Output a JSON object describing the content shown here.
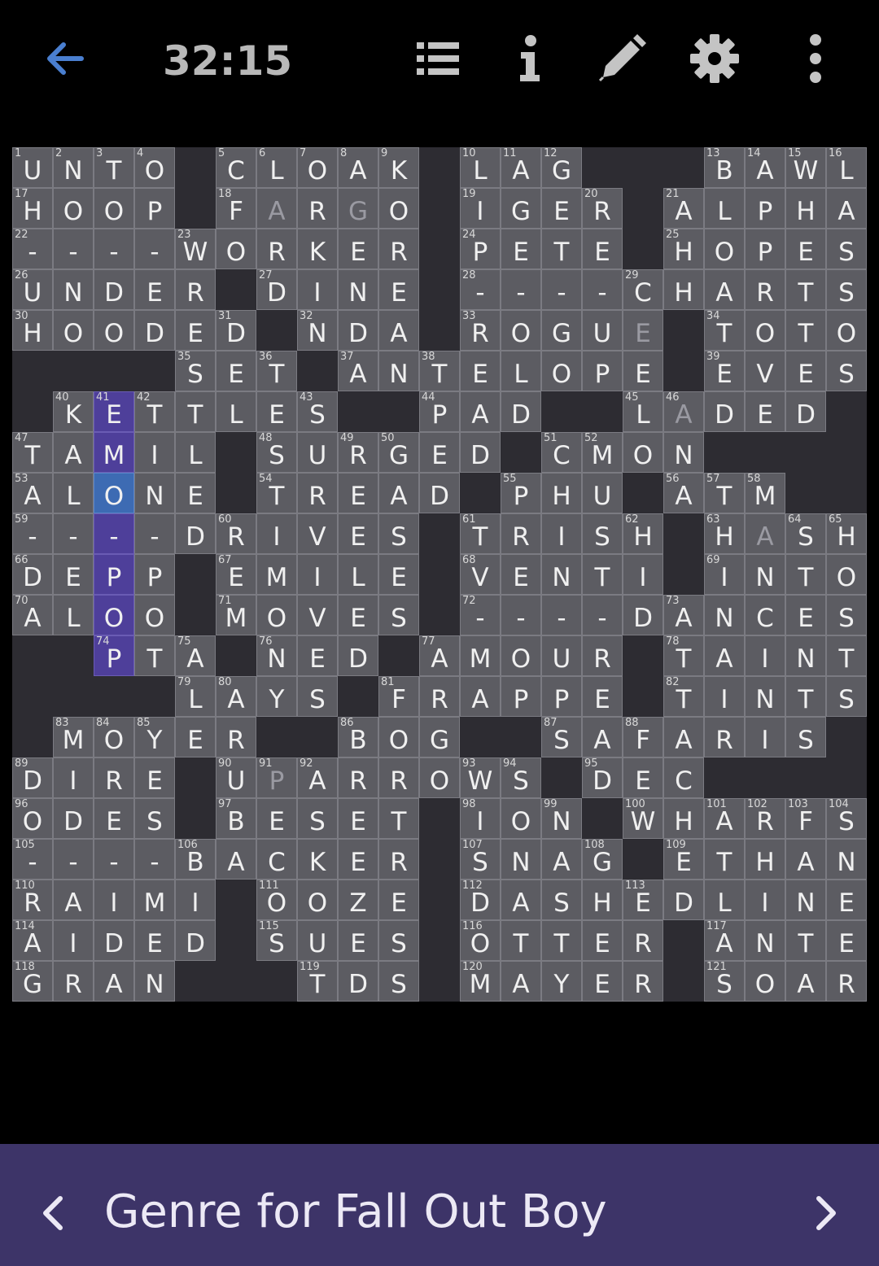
{
  "toolbar": {
    "timer": "32:15",
    "icons": [
      "back-arrow-icon",
      "clue-list-icon",
      "info-icon",
      "pencil-icon",
      "gear-icon",
      "more-vertical-icon"
    ],
    "colors": {
      "back_arrow": "#4a7fd0",
      "icons": "#c4c4c4",
      "timer": "#b8b8b8"
    }
  },
  "grid": {
    "size": 21,
    "rows": [
      "UNTO.CLOAK.LAG...BAWL",
      "HOOP.FARGO.IGER.ALPHA",
      "----WORKER.PETE.HOPES",
      "UNDER.DINE.----CHARTS",
      "HOODED.NDA.ROGUE.TOTO",
      "....SET.ANTELOPE.EVES",
      ".KETTLES..PAD..LADED.",
      "TAMIL.SURGED.CMON....",
      "ALONE.TREAD.PHU.ATM..",
      "----DRIVES.TRISH.HASH",
      "DEPP.EMILE.VENTI.INTO",
      "ALOO.MOVES.----DANCES",
      "..PTA.NED.AMOUR.TAINT",
      "....LAYS.FRAPPE.TINTS",
      ".MOYER..BOG..SAFARIS.",
      "DIRE.UPARROWS.DEC....",
      "ODES.BESET.ION.WHARFS",
      "----BACKER.SNAG.ETHAN",
      "RAIMI.OOZE.DASHEDLINE",
      "AIDED.SUES.OTTER.ANTE",
      "GRAN...TDS.MAYER.SOAR"
    ],
    "numbers": [
      {
        "r": 0,
        "c": 0,
        "n": "1"
      },
      {
        "r": 0,
        "c": 1,
        "n": "2"
      },
      {
        "r": 0,
        "c": 2,
        "n": "3"
      },
      {
        "r": 0,
        "c": 3,
        "n": "4"
      },
      {
        "r": 0,
        "c": 5,
        "n": "5"
      },
      {
        "r": 0,
        "c": 6,
        "n": "6"
      },
      {
        "r": 0,
        "c": 7,
        "n": "7"
      },
      {
        "r": 0,
        "c": 8,
        "n": "8"
      },
      {
        "r": 0,
        "c": 9,
        "n": "9"
      },
      {
        "r": 0,
        "c": 11,
        "n": "10"
      },
      {
        "r": 0,
        "c": 12,
        "n": "11"
      },
      {
        "r": 0,
        "c": 13,
        "n": "12"
      },
      {
        "r": 0,
        "c": 17,
        "n": "13"
      },
      {
        "r": 0,
        "c": 18,
        "n": "14"
      },
      {
        "r": 0,
        "c": 19,
        "n": "15"
      },
      {
        "r": 0,
        "c": 20,
        "n": "16"
      },
      {
        "r": 1,
        "c": 0,
        "n": "17"
      },
      {
        "r": 1,
        "c": 5,
        "n": "18"
      },
      {
        "r": 1,
        "c": 11,
        "n": "19"
      },
      {
        "r": 1,
        "c": 14,
        "n": "20"
      },
      {
        "r": 1,
        "c": 16,
        "n": "21"
      },
      {
        "r": 2,
        "c": 0,
        "n": "22"
      },
      {
        "r": 2,
        "c": 4,
        "n": "23"
      },
      {
        "r": 2,
        "c": 11,
        "n": "24"
      },
      {
        "r": 2,
        "c": 16,
        "n": "25"
      },
      {
        "r": 3,
        "c": 0,
        "n": "26"
      },
      {
        "r": 3,
        "c": 6,
        "n": "27"
      },
      {
        "r": 3,
        "c": 11,
        "n": "28"
      },
      {
        "r": 3,
        "c": 15,
        "n": "29"
      },
      {
        "r": 4,
        "c": 0,
        "n": "30"
      },
      {
        "r": 4,
        "c": 5,
        "n": "31"
      },
      {
        "r": 4,
        "c": 7,
        "n": "32"
      },
      {
        "r": 4,
        "c": 11,
        "n": "33"
      },
      {
        "r": 4,
        "c": 17,
        "n": "34"
      },
      {
        "r": 5,
        "c": 4,
        "n": "35"
      },
      {
        "r": 5,
        "c": 6,
        "n": "36"
      },
      {
        "r": 5,
        "c": 8,
        "n": "37"
      },
      {
        "r": 5,
        "c": 10,
        "n": "38"
      },
      {
        "r": 5,
        "c": 17,
        "n": "39"
      },
      {
        "r": 6,
        "c": 1,
        "n": "40"
      },
      {
        "r": 6,
        "c": 2,
        "n": "41"
      },
      {
        "r": 6,
        "c": 3,
        "n": "42"
      },
      {
        "r": 6,
        "c": 7,
        "n": "43"
      },
      {
        "r": 6,
        "c": 10,
        "n": "44"
      },
      {
        "r": 6,
        "c": 15,
        "n": "45"
      },
      {
        "r": 6,
        "c": 16,
        "n": "46"
      },
      {
        "r": 7,
        "c": 0,
        "n": "47"
      },
      {
        "r": 7,
        "c": 6,
        "n": "48"
      },
      {
        "r": 7,
        "c": 8,
        "n": "49"
      },
      {
        "r": 7,
        "c": 9,
        "n": "50"
      },
      {
        "r": 7,
        "c": 13,
        "n": "51"
      },
      {
        "r": 7,
        "c": 14,
        "n": "52"
      },
      {
        "r": 8,
        "c": 0,
        "n": "53"
      },
      {
        "r": 8,
        "c": 6,
        "n": "54"
      },
      {
        "r": 8,
        "c": 12,
        "n": "55"
      },
      {
        "r": 8,
        "c": 16,
        "n": "56"
      },
      {
        "r": 8,
        "c": 17,
        "n": "57"
      },
      {
        "r": 8,
        "c": 18,
        "n": "58"
      },
      {
        "r": 9,
        "c": 0,
        "n": "59"
      },
      {
        "r": 9,
        "c": 5,
        "n": "60"
      },
      {
        "r": 9,
        "c": 11,
        "n": "61"
      },
      {
        "r": 9,
        "c": 15,
        "n": "62"
      },
      {
        "r": 9,
        "c": 17,
        "n": "63"
      },
      {
        "r": 9,
        "c": 19,
        "n": "64"
      },
      {
        "r": 9,
        "c": 20,
        "n": "65"
      },
      {
        "r": 10,
        "c": 0,
        "n": "66"
      },
      {
        "r": 10,
        "c": 5,
        "n": "67"
      },
      {
        "r": 10,
        "c": 11,
        "n": "68"
      },
      {
        "r": 10,
        "c": 17,
        "n": "69"
      },
      {
        "r": 11,
        "c": 0,
        "n": "70"
      },
      {
        "r": 11,
        "c": 5,
        "n": "71"
      },
      {
        "r": 11,
        "c": 11,
        "n": "72"
      },
      {
        "r": 11,
        "c": 16,
        "n": "73"
      },
      {
        "r": 12,
        "c": 2,
        "n": "74"
      },
      {
        "r": 12,
        "c": 4,
        "n": "75"
      },
      {
        "r": 12,
        "c": 6,
        "n": "76"
      },
      {
        "r": 12,
        "c": 10,
        "n": "77"
      },
      {
        "r": 12,
        "c": 16,
        "n": "78"
      },
      {
        "r": 13,
        "c": 4,
        "n": "79"
      },
      {
        "r": 13,
        "c": 5,
        "n": "80"
      },
      {
        "r": 13,
        "c": 9,
        "n": "81"
      },
      {
        "r": 13,
        "c": 16,
        "n": "82"
      },
      {
        "r": 14,
        "c": 1,
        "n": "83"
      },
      {
        "r": 14,
        "c": 2,
        "n": "84"
      },
      {
        "r": 14,
        "c": 3,
        "n": "85"
      },
      {
        "r": 14,
        "c": 8,
        "n": "86"
      },
      {
        "r": 14,
        "c": 13,
        "n": "87"
      },
      {
        "r": 14,
        "c": 15,
        "n": "88"
      },
      {
        "r": 15,
        "c": 0,
        "n": "89"
      },
      {
        "r": 15,
        "c": 5,
        "n": "90"
      },
      {
        "r": 15,
        "c": 6,
        "n": "91"
      },
      {
        "r": 15,
        "c": 7,
        "n": "92"
      },
      {
        "r": 15,
        "c": 11,
        "n": "93"
      },
      {
        "r": 15,
        "c": 12,
        "n": "94"
      },
      {
        "r": 15,
        "c": 14,
        "n": "95"
      },
      {
        "r": 16,
        "c": 0,
        "n": "96"
      },
      {
        "r": 16,
        "c": 5,
        "n": "97"
      },
      {
        "r": 16,
        "c": 11,
        "n": "98"
      },
      {
        "r": 16,
        "c": 13,
        "n": "99"
      },
      {
        "r": 16,
        "c": 15,
        "n": "100"
      },
      {
        "r": 16,
        "c": 17,
        "n": "101"
      },
      {
        "r": 16,
        "c": 18,
        "n": "102"
      },
      {
        "r": 16,
        "c": 19,
        "n": "103"
      },
      {
        "r": 16,
        "c": 20,
        "n": "104"
      },
      {
        "r": 17,
        "c": 0,
        "n": "105"
      },
      {
        "r": 17,
        "c": 4,
        "n": "106"
      },
      {
        "r": 17,
        "c": 11,
        "n": "107"
      },
      {
        "r": 17,
        "c": 14,
        "n": "108"
      },
      {
        "r": 17,
        "c": 16,
        "n": "109"
      },
      {
        "r": 18,
        "c": 0,
        "n": "110"
      },
      {
        "r": 18,
        "c": 6,
        "n": "111"
      },
      {
        "r": 18,
        "c": 11,
        "n": "112"
      },
      {
        "r": 18,
        "c": 15,
        "n": "113"
      },
      {
        "r": 19,
        "c": 0,
        "n": "114"
      },
      {
        "r": 19,
        "c": 6,
        "n": "115"
      },
      {
        "r": 19,
        "c": 11,
        "n": "116"
      },
      {
        "r": 19,
        "c": 17,
        "n": "117"
      },
      {
        "r": 20,
        "c": 0,
        "n": "118"
      },
      {
        "r": 20,
        "c": 7,
        "n": "119"
      },
      {
        "r": 20,
        "c": 11,
        "n": "120"
      },
      {
        "r": 20,
        "c": 17,
        "n": "121"
      }
    ],
    "pencil_cells": [
      [
        1,
        6
      ],
      [
        1,
        8
      ],
      [
        4,
        15
      ],
      [
        4,
        16
      ],
      [
        6,
        16
      ],
      [
        9,
        18
      ],
      [
        15,
        6
      ]
    ],
    "selected_cell": [
      8,
      2
    ],
    "highlighted_word": [
      [
        6,
        2
      ],
      [
        7,
        2
      ],
      [
        8,
        2
      ],
      [
        9,
        2
      ],
      [
        10,
        2
      ],
      [
        11,
        2
      ],
      [
        12,
        2
      ]
    ],
    "colors": {
      "cell": "#5c5c62",
      "block": "#2d2c32",
      "highlight": "#4e3f9a",
      "selected": "#3d6bb3",
      "letter": "#f0f0f0",
      "pencil": "#9a9aa2"
    }
  },
  "clue_bar": {
    "text": "Genre for Fall Out Boy",
    "prev_icon": "chevron-left-icon",
    "next_icon": "chevron-right-icon",
    "background": "#3d3468"
  }
}
